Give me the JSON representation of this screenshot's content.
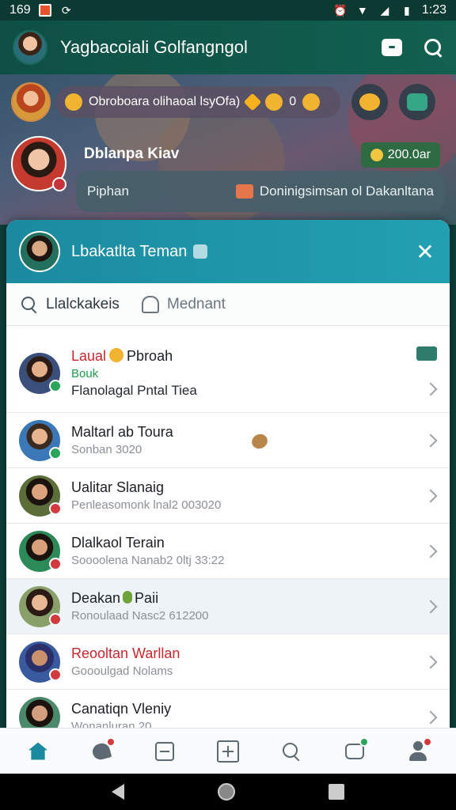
{
  "status_bar": {
    "left": "169",
    "time": "1:23"
  },
  "app_bar": {
    "title": "Yagbacoiali Golfangngol"
  },
  "background_feed": {
    "notice_text": "Obroboara olihaoal lsyOfa)",
    "notice_suffix": "0",
    "contact_name": "Dblanpa Kiav",
    "price": "200.0ar",
    "message_left": "Piphan",
    "message_right": "Doninigsimsan ol Dakanltana"
  },
  "sheet": {
    "title": "Lbakatlta Teman",
    "tabs": [
      {
        "label": "Llalckakeis"
      },
      {
        "label": "Mednant"
      }
    ],
    "contacts": [
      {
        "name_prefix": "Laual",
        "name_rest": "Pbroah",
        "tag": "Bouk",
        "detail": "Flanolagal Pntal Tiea"
      },
      {
        "name": "Maltarl ab Toura",
        "sub": "Sonban 3020"
      },
      {
        "name": "Ualitar Slanaig",
        "sub": "Penleasomonk lnal2 003020"
      },
      {
        "name": "Dlalkaol Terain",
        "sub": "Soooolena Nanab2 0ltj 33:22"
      },
      {
        "name_prefix": "Deakan",
        "name_rest": "Paii",
        "sub": "Ronoulaad Nasc2 612200"
      },
      {
        "name": "Reooltan Warllan",
        "sub": "Goooulgad Nolams"
      },
      {
        "name": "Canatiqn Vleniy",
        "sub": "Wonanluran 20"
      }
    ]
  },
  "colors": {
    "app_bar": "#0f4f45",
    "sheet_header": "#1b8aa0",
    "accent_red": "#c8262c",
    "accent_green": "#1f9a4e"
  }
}
